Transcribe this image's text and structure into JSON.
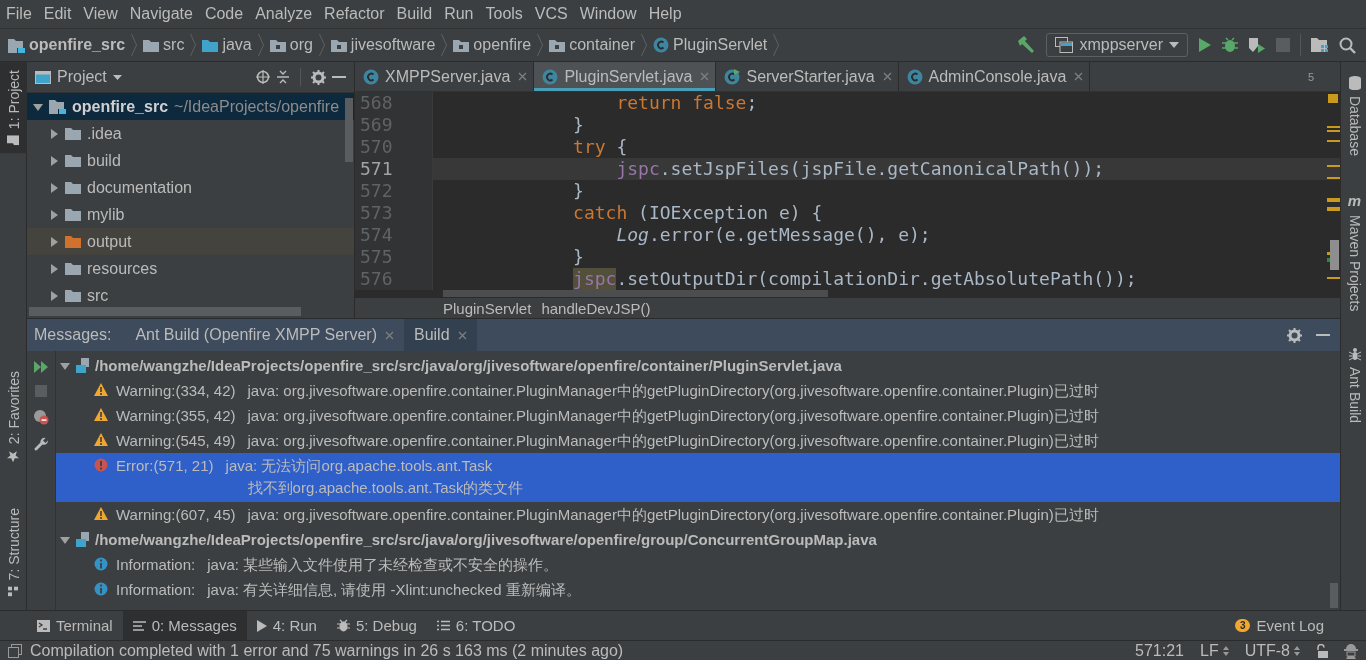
{
  "menu": [
    "File",
    "Edit",
    "View",
    "Navigate",
    "Code",
    "Analyze",
    "Refactor",
    "Build",
    "Run",
    "Tools",
    "VCS",
    "Window",
    "Help"
  ],
  "breadcrumbs": [
    {
      "label": "openfire_src",
      "kind": "module"
    },
    {
      "label": "src",
      "kind": "folder"
    },
    {
      "label": "java",
      "kind": "source"
    },
    {
      "label": "org",
      "kind": "package"
    },
    {
      "label": "jivesoftware",
      "kind": "package"
    },
    {
      "label": "openfire",
      "kind": "package"
    },
    {
      "label": "container",
      "kind": "package"
    },
    {
      "label": "PluginServlet",
      "kind": "class"
    }
  ],
  "run_config": {
    "label": "xmppserver"
  },
  "left_stripe": [
    {
      "label": "1: Project",
      "kind": "project",
      "selected": true
    },
    {
      "label": "2: Favorites",
      "kind": "favorites",
      "selected": false
    },
    {
      "label": "7: Structure",
      "kind": "structure",
      "selected": false
    }
  ],
  "right_stripe": [
    {
      "label": "Database",
      "kind": "database"
    },
    {
      "label": "Maven Projects",
      "kind": "maven",
      "glyph": "m"
    },
    {
      "label": "Ant Build",
      "kind": "ant"
    }
  ],
  "project_panel": {
    "title": "Project",
    "root": {
      "label": "openfire_src",
      "path": "~/IdeaProjects/openfire",
      "expanded": true,
      "selected": true,
      "children": [
        {
          "label": ".idea",
          "expanded": false,
          "excluded": false
        },
        {
          "label": "build",
          "expanded": false,
          "excluded": false
        },
        {
          "label": "documentation",
          "expanded": false,
          "excluded": false
        },
        {
          "label": "mylib",
          "expanded": false,
          "excluded": false
        },
        {
          "label": "output",
          "expanded": false,
          "excluded": true
        },
        {
          "label": "resources",
          "expanded": false,
          "excluded": false
        },
        {
          "label": "src",
          "expanded": false,
          "excluded": false
        }
      ]
    }
  },
  "editor": {
    "tabs": [
      {
        "label": "XMPPServer.java",
        "kind": "class",
        "selected": false
      },
      {
        "label": "PluginServlet.java",
        "kind": "class",
        "selected": true
      },
      {
        "label": "ServerStarter.java",
        "kind": "runnable",
        "selected": false
      },
      {
        "label": "AdminConsole.java",
        "kind": "class",
        "selected": false
      }
    ],
    "tab_count": "5",
    "lines": [
      {
        "number": "568",
        "current": false,
        "tokens": [
          {
            "kind": "keyword",
            "text": "                return false"
          },
          {
            "kind": "plain",
            "text": ";"
          }
        ]
      },
      {
        "number": "569",
        "current": false,
        "tokens": [
          {
            "kind": "plain",
            "text": "            }"
          }
        ]
      },
      {
        "number": "570",
        "current": false,
        "tokens": [
          {
            "kind": "keyword",
            "text": "            try"
          },
          {
            "kind": "plain",
            "text": " {"
          }
        ]
      },
      {
        "number": "571",
        "current": true,
        "tokens": [
          {
            "kind": "field",
            "text": "                jspc"
          },
          {
            "kind": "plain",
            "text": ".setJspFiles(jspFile.getCanonicalPath());"
          }
        ]
      },
      {
        "number": "572",
        "current": false,
        "tokens": [
          {
            "kind": "plain",
            "text": "            }"
          }
        ]
      },
      {
        "number": "573",
        "current": false,
        "tokens": [
          {
            "kind": "keyword",
            "text": "            catch"
          },
          {
            "kind": "plain",
            "text": " (IOException e) {"
          }
        ]
      },
      {
        "number": "574",
        "current": false,
        "tokens": [
          {
            "kind": "static_class",
            "text": "                Log"
          },
          {
            "kind": "plain",
            "text": ".error(e.getMessage(), e);"
          }
        ]
      },
      {
        "number": "575",
        "current": false,
        "tokens": [
          {
            "kind": "plain",
            "text": "            }"
          }
        ]
      },
      {
        "number": "576",
        "current": false,
        "tokens": [
          {
            "kind": "field_usage",
            "text": "            jspc"
          },
          {
            "kind": "plain",
            "text": ".setOutputDir(compilationDir.getAbsolutePath());"
          }
        ]
      }
    ],
    "breadcrumbs": [
      "PluginServlet",
      "handleDevJSP()"
    ]
  },
  "messages": {
    "title": "Messages:",
    "tabs": [
      {
        "label": "Ant Build (Openfire XMPP Server)",
        "selected": false
      },
      {
        "label": "Build",
        "selected": true
      }
    ],
    "groups": [
      {
        "path": "/home/wangzhe/IdeaProjects/openfire_src/src/java/org/jivesoftware/openfire/container/PluginServlet.java",
        "expanded": true,
        "items": [
          {
            "kind": "warning",
            "selected": false,
            "location": "Warning:(334, 42)",
            "lines": [
              "java: org.jivesoftware.openfire.container.PluginManager中的getPluginDirectory(org.jivesoftware.openfire.container.Plugin)已过时"
            ]
          },
          {
            "kind": "warning",
            "selected": false,
            "location": "Warning:(355, 42)",
            "lines": [
              "java: org.jivesoftware.openfire.container.PluginManager中的getPluginDirectory(org.jivesoftware.openfire.container.Plugin)已过时"
            ]
          },
          {
            "kind": "warning",
            "selected": false,
            "location": "Warning:(545, 49)",
            "lines": [
              "java: org.jivesoftware.openfire.container.PluginManager中的getPluginDirectory(org.jivesoftware.openfire.container.Plugin)已过时"
            ]
          },
          {
            "kind": "error",
            "selected": true,
            "location": "Error:(571, 21)",
            "lines": [
              "java: 无法访问org.apache.tools.ant.Task",
              "找不到org.apache.tools.ant.Task的类文件"
            ]
          },
          {
            "kind": "warning",
            "selected": false,
            "location": "Warning:(607, 45)",
            "lines": [
              "java: org.jivesoftware.openfire.container.PluginManager中的getPluginDirectory(org.jivesoftware.openfire.container.Plugin)已过时"
            ]
          }
        ]
      },
      {
        "path": "/home/wangzhe/IdeaProjects/openfire_src/src/java/org/jivesoftware/openfire/group/ConcurrentGroupMap.java",
        "expanded": true,
        "items": [
          {
            "kind": "info",
            "selected": false,
            "location": "Information:",
            "lines": [
              "java: 某些输入文件使用了未经检查或不安全的操作。"
            ]
          },
          {
            "kind": "info",
            "selected": false,
            "location": "Information:",
            "lines": [
              "java: 有关详细信息, 请使用 -Xlint:unchecked 重新编译。"
            ]
          }
        ]
      }
    ]
  },
  "tool_windows": [
    {
      "label": "Terminal",
      "kind": "terminal",
      "selected": false
    },
    {
      "label": "0: Messages",
      "kind": "messages",
      "selected": true
    },
    {
      "label": "4: Run",
      "kind": "run",
      "selected": false
    },
    {
      "label": "5: Debug",
      "kind": "debug",
      "selected": false
    },
    {
      "label": "6: TODO",
      "kind": "todo",
      "selected": false
    }
  ],
  "event_log": {
    "label": "Event Log",
    "badge": "3"
  },
  "status_bar": {
    "message": "Compilation completed with 1 error and 75 warnings in 26 s 163 ms (2 minutes ago)",
    "position": "571:21",
    "line_separator": "LF",
    "encoding": "UTF-8"
  }
}
